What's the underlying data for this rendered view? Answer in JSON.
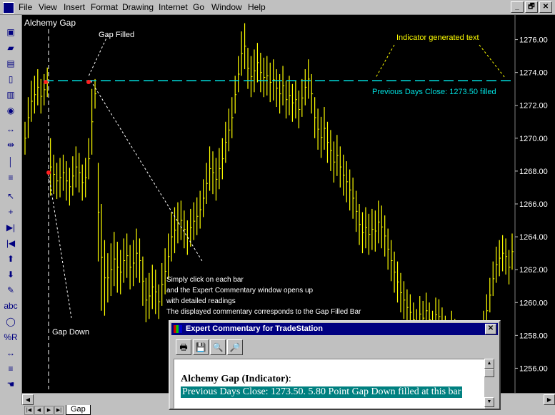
{
  "menu": [
    "File",
    "View",
    "Insert",
    "Format",
    "Drawing",
    "Internet",
    "Go",
    "Window",
    "Help"
  ],
  "window_buttons": [
    "_",
    "🗗",
    "✕"
  ],
  "chart": {
    "title": "Alchemy Gap",
    "annotations": {
      "gap_filled": "Gap Filled",
      "gap_down": "Gap Down",
      "indicator_text": "Indicator generated text",
      "prev_close": "Previous Days Close: 1273.50 filled",
      "click_note": [
        "Simply click on each bar",
        "and the Expert Commentary window opens up",
        "with detailed readings",
        "The displayed commentary corresponds to the Gap Filled Bar"
      ]
    },
    "colors": {
      "bars": "#ffff00",
      "close_line": "#00ffff",
      "prev_close_text": "#00ffff",
      "indicator_text": "#ffff00",
      "dots": "#ff0000"
    }
  },
  "chart_data": {
    "type": "bar",
    "title": "Alchemy Gap",
    "y_ticks": [
      "1276.00",
      "1274.00",
      "1272.00",
      "1270.00",
      "1268.00",
      "1266.00",
      "1264.00",
      "1262.00",
      "1260.00",
      "1258.00",
      "1256.00"
    ],
    "ylim": [
      1254.5,
      1277.5
    ],
    "previous_close": 1273.5,
    "grid": false,
    "highs": [
      1271,
      1272.5,
      1273.5,
      1273.8,
      1274.2,
      1273.6,
      1273.9,
      1274.3,
      1270,
      1269,
      1268.5,
      1268.8,
      1269,
      1268.6,
      1268.2,
      1268.9,
      1269.5,
      1269.1,
      1268.4,
      1268.8,
      1270,
      1273,
      1273.6,
      1268.5,
      1266,
      1263.8,
      1263,
      1263.6,
      1264.3,
      1263.7,
      1263.2,
      1263.9,
      1264.2,
      1263.5,
      1263.8,
      1264.5,
      1263.9,
      1262.8,
      1261.5,
      1261.8,
      1262.3,
      1262,
      1261.1,
      1262.4,
      1263.3,
      1264.2,
      1265.5,
      1265.8,
      1266.1,
      1266.2,
      1265.6,
      1265,
      1265.7,
      1266.1,
      1266.4,
      1266.8,
      1267.5,
      1268.5,
      1269.5,
      1269.2,
      1268.8,
      1269.4,
      1270,
      1271,
      1271.8,
      1272.5,
      1273.8,
      1275,
      1276.5,
      1277,
      1275.5,
      1275,
      1275.4,
      1275.8,
      1275.2,
      1274.9,
      1275,
      1274.6,
      1274.8,
      1274.2,
      1273.9,
      1274.4,
      1273.5,
      1273.8,
      1273.3,
      1273.5,
      1272.9,
      1273.6,
      1274.2,
      1274.8,
      1273.9,
      1272.5,
      1271.8,
      1271.3,
      1271.9,
      1271,
      1270.5,
      1269.8,
      1270.2,
      1269.5,
      1269,
      1268.6,
      1268.1,
      1267.6,
      1266.8,
      1266,
      1265.5,
      1265.8,
      1265.4,
      1265.7,
      1265.6,
      1266.2,
      1265.9,
      1265.3,
      1264.5,
      1263.8,
      1263.1,
      1262.5,
      1261.8,
      1261.3,
      1260.8,
      1260.5,
      1260,
      1259.6,
      1260.4,
      1260.1,
      1260.6,
      1260,
      1259.5,
      1260.3,
      1260.2,
      1259.7,
      1259.2,
      1258.8,
      1259.5,
      1259,
      1258.5,
      1258,
      1257.6,
      1258.1,
      1258.4,
      1257.8,
      1258,
      1258.5,
      1259.5,
      1260.5,
      1261.5,
      1262.5,
      1263.4,
      1263.8,
      1264.1,
      1263.9,
      1263.2,
      1264.2
    ],
    "lows": [
      1269,
      1270,
      1271,
      1271.5,
      1272,
      1271.5,
      1272,
      1272.5,
      1266.5,
      1266.6,
      1266.3,
      1266.4,
      1266.8,
      1266.2,
      1265.9,
      1266.5,
      1267,
      1266.7,
      1266.2,
      1266.4,
      1267.5,
      1269,
      1271.8,
      1262.5,
      1259.5,
      1259.2,
      1260,
      1260.4,
      1261,
      1260.6,
      1260.5,
      1261.2,
      1261.5,
      1260.8,
      1261,
      1261.5,
      1261.2,
      1259.8,
      1258.8,
      1259,
      1259.6,
      1259.3,
      1259,
      1259.8,
      1260.5,
      1261.4,
      1262.5,
      1263,
      1263.6,
      1263.8,
      1263.3,
      1262.9,
      1263.4,
      1263.8,
      1264.1,
      1264.5,
      1265.2,
      1266,
      1266.8,
      1266.6,
      1266.2,
      1266.9,
      1267.5,
      1268.5,
      1269.2,
      1270,
      1271.5,
      1272.8,
      1273.8,
      1274.2,
      1273,
      1272.5,
      1272.8,
      1273.4,
      1272.8,
      1272.5,
      1272.6,
      1272.2,
      1272.3,
      1271.9,
      1271.5,
      1272,
      1271.2,
      1271.4,
      1271,
      1271.2,
      1270.6,
      1271.3,
      1272,
      1272.4,
      1271.5,
      1270,
      1269.3,
      1268.8,
      1269.3,
      1268.5,
      1268,
      1267.3,
      1267.7,
      1267,
      1266.5,
      1266.1,
      1265.6,
      1265.1,
      1264.3,
      1263.5,
      1263,
      1263.3,
      1262.9,
      1263.2,
      1263.1,
      1263.6,
      1263.3,
      1262.8,
      1262,
      1261.3,
      1260.6,
      1260,
      1259.4,
      1259,
      1258.6,
      1258.3,
      1257.9,
      1257.6,
      1258.2,
      1258,
      1258.4,
      1257.9,
      1257.5,
      1258.2,
      1258.1,
      1257.6,
      1257.2,
      1256.8,
      1257.4,
      1257,
      1256.6,
      1256.2,
      1255.8,
      1256.2,
      1256.5,
      1256,
      1256.2,
      1256.6,
      1257.5,
      1258.5,
      1259.4,
      1260.4,
      1261.2,
      1261.6,
      1261.9,
      1261.7,
      1261.1,
      1262
    ]
  },
  "tabs": {
    "nav_buttons": [
      "|◀",
      "◀",
      "▶",
      "▶|"
    ],
    "active_tab": "Gap"
  },
  "dialog": {
    "title": "Expert Commentary for TradeStation",
    "close": "✕",
    "tools": [
      "🖶",
      "💾",
      "🔍",
      "🔎"
    ],
    "heading": "Alchemy Gap (Indicator)",
    "heading_colon": ":",
    "commentary": "Previous Days Close: 1273.50. 5.80 Point Gap Down filled at this bar"
  }
}
